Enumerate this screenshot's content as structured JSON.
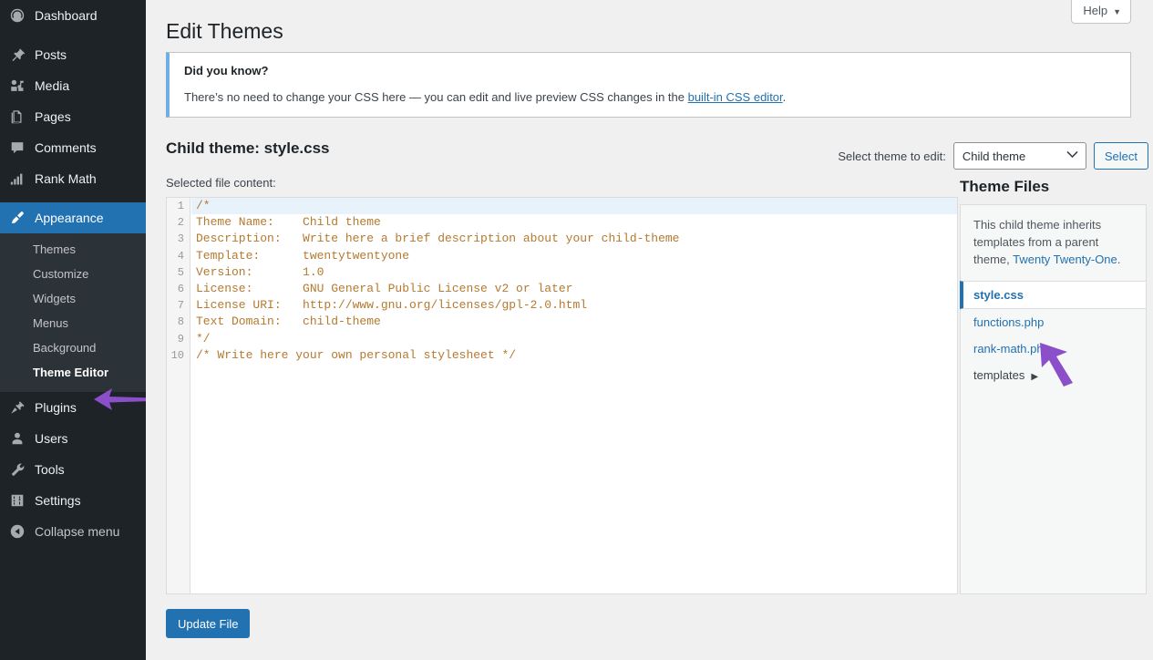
{
  "sidebar": {
    "items": [
      {
        "label": "Dashboard",
        "icon": "dashboard-icon"
      },
      {
        "label": "Posts",
        "icon": "pin-icon"
      },
      {
        "label": "Media",
        "icon": "media-icon"
      },
      {
        "label": "Pages",
        "icon": "pages-icon"
      },
      {
        "label": "Comments",
        "icon": "comment-icon"
      },
      {
        "label": "Rank Math",
        "icon": "chart-icon"
      },
      {
        "label": "Appearance",
        "icon": "brush-icon"
      },
      {
        "label": "Plugins",
        "icon": "plug-icon"
      },
      {
        "label": "Users",
        "icon": "user-icon"
      },
      {
        "label": "Tools",
        "icon": "wrench-icon"
      },
      {
        "label": "Settings",
        "icon": "sliders-icon"
      }
    ],
    "appearance_submenu": [
      {
        "label": "Themes"
      },
      {
        "label": "Customize"
      },
      {
        "label": "Widgets"
      },
      {
        "label": "Menus"
      },
      {
        "label": "Background"
      },
      {
        "label": "Theme Editor"
      }
    ],
    "collapse_label": "Collapse menu"
  },
  "header": {
    "help_label": "Help",
    "page_title": "Edit Themes"
  },
  "notice": {
    "title": "Did you know?",
    "body_before": "There’s no need to change your CSS here — you can edit and live preview CSS changes in the ",
    "link": "built-in CSS editor",
    "body_after": "."
  },
  "toolbar": {
    "file_title": "Child theme: style.css",
    "select_theme_label": "Select theme to edit:",
    "selected_theme": "Child theme",
    "select_button": "Select",
    "selected_file_label": "Selected file content:",
    "update_button": "Update File"
  },
  "editor": {
    "lines": [
      {
        "n": "1",
        "text": "/*",
        "active": true
      },
      {
        "n": "2",
        "text": "Theme Name:    Child theme",
        "active": false
      },
      {
        "n": "3",
        "text": "Description:   Write here a brief description about your child-theme",
        "active": false
      },
      {
        "n": "4",
        "text": "Template:      twentytwentyone",
        "active": false
      },
      {
        "n": "5",
        "text": "Version:       1.0",
        "active": false
      },
      {
        "n": "6",
        "text": "License:       GNU General Public License v2 or later",
        "active": false
      },
      {
        "n": "7",
        "text": "License URI:   http://www.gnu.org/licenses/gpl-2.0.html",
        "active": false
      },
      {
        "n": "8",
        "text": "Text Domain:   child-theme",
        "active": false
      },
      {
        "n": "9",
        "text": "*/",
        "active": false
      },
      {
        "n": "10",
        "text": "/* Write here your own personal stylesheet */",
        "active": false
      }
    ]
  },
  "theme_files": {
    "title": "Theme Files",
    "note_before": "This child theme inherits templates from a parent theme, ",
    "note_link": "Twenty Twenty-One",
    "note_after": ".",
    "files": [
      {
        "label": "style.css",
        "current": true,
        "folder": false
      },
      {
        "label": "functions.php",
        "current": false,
        "folder": false
      },
      {
        "label": "rank-math.php",
        "current": false,
        "folder": false
      },
      {
        "label": "templates",
        "current": false,
        "folder": true,
        "marker": "▶"
      }
    ]
  },
  "colors": {
    "accent": "#2271b1",
    "sidebar_bg": "#1d2327",
    "submenu_bg": "#2c3338",
    "notice_border": "#72aee6",
    "code_comment": "#b5792f",
    "annotation": "#8b4fc9"
  }
}
